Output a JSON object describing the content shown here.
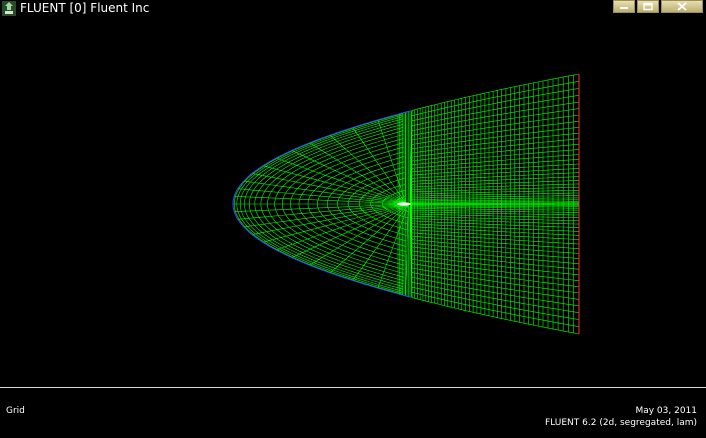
{
  "window": {
    "title": "FLUENT [0] Fluent Inc",
    "icon": "fluent-app-icon",
    "controls": [
      "minimize-icon",
      "maximize-icon",
      "close-icon"
    ]
  },
  "footer": {
    "label": "Grid",
    "date": "May 03, 2011",
    "version": "FLUENT 6.2 (2d, segregated, lam)"
  },
  "colors": {
    "background": "#000000",
    "mesh": "#00ff00",
    "inlet_boundary": "#3a48ff",
    "outlet_boundary": "#ff3030",
    "airfoil": "#ffffff"
  }
}
